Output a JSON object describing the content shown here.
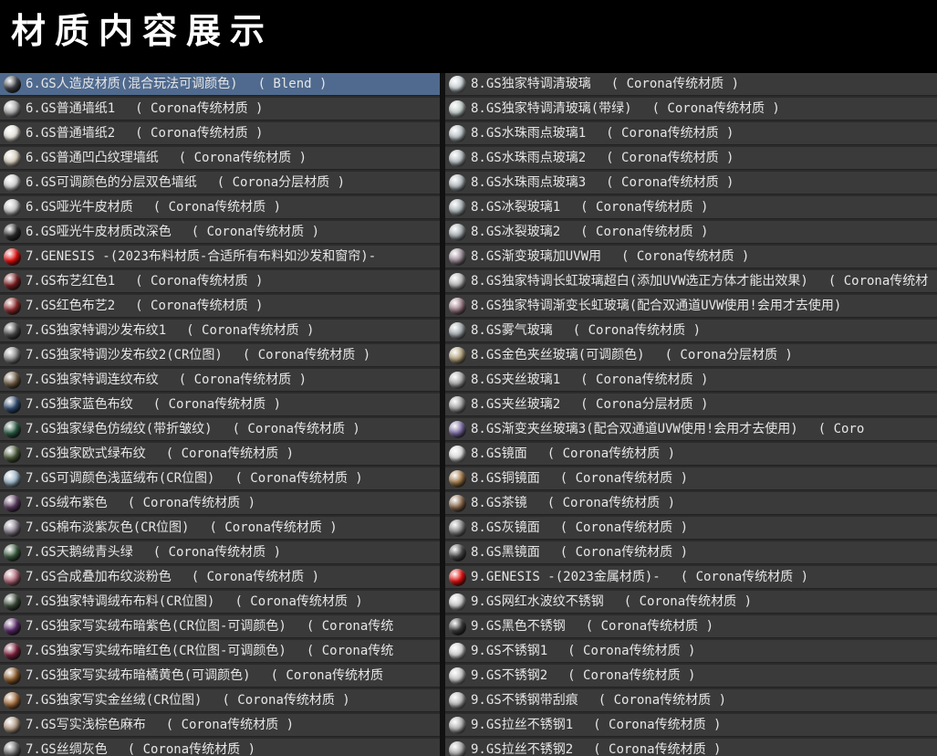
{
  "header": {
    "title": "材质内容展示"
  },
  "colors": {
    "row_bg": "#3a3a3a",
    "row_selected": "#4f6a8e",
    "text": "#e6e6e6",
    "header_bg": "#000000"
  },
  "left_list": [
    {
      "name": "6.GS人造皮材质(混合玩法可调颜色)",
      "tag": "( Blend )",
      "swatch": "#3c3f46",
      "selected": true,
      "icon": "sphere-icon"
    },
    {
      "name": "6.GS普通墙纸1",
      "tag": "( Corona传统材质 )",
      "swatch": "#a8a8a8",
      "icon": "sphere-icon"
    },
    {
      "name": "6.GS普通墙纸2",
      "tag": "( Corona传统材质 )",
      "swatch": "#e6e2da",
      "icon": "sphere-icon"
    },
    {
      "name": "6.GS普通凹凸纹理墙纸",
      "tag": "( Corona传统材质 )",
      "swatch": "#d8cfbe",
      "icon": "sphere-icon"
    },
    {
      "name": "6.GS可调颜色的分层双色墙纸",
      "tag": "( Corona分层材质 )",
      "swatch": "#cfcfcf",
      "icon": "sphere-icon"
    },
    {
      "name": "6.GS哑光牛皮材质",
      "tag": "( Corona传统材质 )",
      "swatch": "#c2c2c2",
      "icon": "sphere-icon"
    },
    {
      "name": "6.GS哑光牛皮材质改深色",
      "tag": "( Corona传统材质 )",
      "swatch": "#2a2a2a",
      "icon": "sphere-icon"
    },
    {
      "name": "7.GENESIS -(2023布料材质-合适所有布料如沙发和窗帘)-",
      "tag": "",
      "swatch": "#e01010",
      "icon": "sphere-icon"
    },
    {
      "name": "7.GS布艺红色1",
      "tag": "( Corona传统材质 )",
      "swatch": "#7a1e22",
      "icon": "sphere-icon"
    },
    {
      "name": "7.GS红色布艺2",
      "tag": "( Corona传统材质 )",
      "swatch": "#8e2a2c",
      "icon": "sphere-icon"
    },
    {
      "name": "7.GS独家特调沙发布纹1",
      "tag": "( Corona传统材质 )",
      "swatch": "#4a4a4a",
      "icon": "sphere-icon"
    },
    {
      "name": "7.GS独家特调沙发布纹2(CR位图)",
      "tag": "( Corona传统材质 )",
      "swatch": "#8a8a8a",
      "icon": "sphere-icon"
    },
    {
      "name": "7.GS独家特调连纹布纹",
      "tag": "( Corona传统材质 )",
      "swatch": "#6e5a44",
      "icon": "sphere-icon"
    },
    {
      "name": "7.GS独家蓝色布纹",
      "tag": "( Corona传统材质 )",
      "swatch": "#2e4a6e",
      "icon": "sphere-icon"
    },
    {
      "name": "7.GS独家绿色仿绒纹(带折皱纹)",
      "tag": "( Corona传统材质 )",
      "swatch": "#2a5a44",
      "icon": "sphere-icon"
    },
    {
      "name": "7.GS独家欧式绿布纹",
      "tag": "( Corona传统材质 )",
      "swatch": "#4a5a3a",
      "icon": "sphere-icon"
    },
    {
      "name": "7.GS可调颜色浅蓝绒布(CR位图)",
      "tag": "( Corona传统材质 )",
      "swatch": "#9cb6c8",
      "icon": "sphere-icon"
    },
    {
      "name": "7.GS绒布紫色",
      "tag": "( Corona传统材质 )",
      "swatch": "#5a3a5e",
      "icon": "sphere-icon"
    },
    {
      "name": "7.GS棉布淡紫灰色(CR位图)",
      "tag": "( Corona传统材质 )",
      "swatch": "#8a8090",
      "icon": "sphere-icon"
    },
    {
      "name": "7.GS天鹅绒青头绿",
      "tag": "( Corona传统材质 )",
      "swatch": "#3a5a3e",
      "icon": "sphere-icon"
    },
    {
      "name": "7.GS合成叠加布纹淡粉色",
      "tag": "( Corona传统材质 )",
      "swatch": "#b06a7a",
      "icon": "sphere-icon"
    },
    {
      "name": "7.GS独家特调绒布布料(CR位图)",
      "tag": "( Corona传统材质 )",
      "swatch": "#3a4a38",
      "icon": "sphere-icon"
    },
    {
      "name": "7.GS独家写实绒布暗紫色(CR位图-可调颜色)",
      "tag": "( Corona传统",
      "swatch": "#5a2a6a",
      "icon": "sphere-icon"
    },
    {
      "name": "7.GS独家写实绒布暗红色(CR位图-可调颜色)",
      "tag": "( Corona传统",
      "swatch": "#7a1e3a",
      "icon": "sphere-icon"
    },
    {
      "name": "7.GS独家写实绒布暗橘黄色(可调颜色)",
      "tag": "( Corona传统材质",
      "swatch": "#8a5a2a",
      "icon": "sphere-icon"
    },
    {
      "name": "7.GS独家写实金丝绒(CR位图)",
      "tag": "( Corona传统材质 )",
      "swatch": "#a06a3a",
      "icon": "sphere-icon"
    },
    {
      "name": "7.GS写实浅棕色麻布",
      "tag": "( Corona传统材质 )",
      "swatch": "#b09a84",
      "icon": "sphere-icon"
    },
    {
      "name": "7.GS丝绸灰色",
      "tag": "( Corona传统材质 )",
      "swatch": "#6a6a6a",
      "icon": "sphere-icon"
    }
  ],
  "right_list": [
    {
      "name": "8.GS独家特调清玻璃",
      "tag": "( Corona传统材质 )",
      "swatch": "#c8d0d4",
      "icon": "glass-icon"
    },
    {
      "name": "8.GS独家特调清玻璃(带绿)",
      "tag": "( Corona传统材质 )",
      "swatch": "#c0ccc8",
      "icon": "glass-icon"
    },
    {
      "name": "8.GS水珠雨点玻璃1",
      "tag": "( Corona传统材质 )",
      "swatch": "#b8c0c4",
      "icon": "glass-icon"
    },
    {
      "name": "8.GS水珠雨点玻璃2",
      "tag": "( Corona传统材质 )",
      "swatch": "#b4bcc0",
      "icon": "glass-icon"
    },
    {
      "name": "8.GS水珠雨点玻璃3",
      "tag": "( Corona传统材质 )",
      "swatch": "#b0b8bc",
      "icon": "glass-icon"
    },
    {
      "name": "8.GS冰裂玻璃1",
      "tag": "( Corona传统材质 )",
      "swatch": "#a8b0b4",
      "icon": "glass-icon"
    },
    {
      "name": "8.GS冰裂玻璃2",
      "tag": "( Corona传统材质 )",
      "swatch": "#a4acb0",
      "icon": "glass-icon"
    },
    {
      "name": "8.GS渐变玻璃加UVW用",
      "tag": "( Corona传统材质 )",
      "swatch": "#9a8a96",
      "icon": "glass-icon"
    },
    {
      "name": "8.GS独家特调长虹玻璃超白(添加UVW选正方体才能出效果)",
      "tag": "( Corona传统材",
      "swatch": "#b4b4b4",
      "icon": "glass-icon"
    },
    {
      "name": "8.GS独家特调渐变长虹玻璃(配合双通道UVW使用!会用才去使用)",
      "tag": "",
      "swatch": "#9a7a86",
      "icon": "glass-icon"
    },
    {
      "name": "8.GS雾气玻璃",
      "tag": "( Corona传统材质 )",
      "swatch": "#a0a8ac",
      "icon": "glass-icon"
    },
    {
      "name": "8.GS金色夹丝玻璃(可调颜色)",
      "tag": "( Corona分层材质 )",
      "swatch": "#b0a07a",
      "icon": "glass-icon"
    },
    {
      "name": "8.GS夹丝玻璃1",
      "tag": "( Corona传统材质 )",
      "swatch": "#a8a8a8",
      "icon": "glass-icon"
    },
    {
      "name": "8.GS夹丝玻璃2",
      "tag": "( Corona分层材质 )",
      "swatch": "#a0a0a0",
      "icon": "glass-icon"
    },
    {
      "name": "8.GS渐变夹丝玻璃3(配合双通道UVW使用!会用才去使用)",
      "tag": "( Coro",
      "swatch": "#7a6aa0",
      "icon": "glass-icon"
    },
    {
      "name": "8.GS镜面",
      "tag": "( Corona传统材质 )",
      "swatch": "#d8d8d8",
      "icon": "mirror-sphere-icon"
    },
    {
      "name": "8.GS铜镜面",
      "tag": "( Corona传统材质 )",
      "swatch": "#a07848",
      "icon": "mirror-sphere-icon"
    },
    {
      "name": "8.GS茶镜",
      "tag": "( Corona传统材质 )",
      "swatch": "#8a6a4e",
      "icon": "mirror-sphere-icon"
    },
    {
      "name": "8.GS灰镜面",
      "tag": "( Corona传统材质 )",
      "swatch": "#8a8a8a",
      "icon": "mirror-sphere-icon"
    },
    {
      "name": "8.GS黑镜面",
      "tag": "( Corona传统材质 )",
      "swatch": "#4a4a4a",
      "icon": "mirror-sphere-icon"
    },
    {
      "name": "9.GENESIS -(2023金属材质)-",
      "tag": "( Corona传统材质 )",
      "swatch": "#e01010",
      "icon": "sphere-icon"
    },
    {
      "name": "9.GS网红水波纹不锈钢",
      "tag": "( Corona传统材质 )",
      "swatch": "#c8c8c8",
      "icon": "metal-sphere-icon"
    },
    {
      "name": "9.GS黑色不锈钢",
      "tag": "( Corona传统材质 )",
      "swatch": "#3a3a3a",
      "icon": "metal-sphere-icon"
    },
    {
      "name": "9.GS不锈钢1",
      "tag": "( Corona传统材质 )",
      "swatch": "#cfcfcf",
      "icon": "metal-sphere-icon"
    },
    {
      "name": "9.GS不锈钢2",
      "tag": "( Corona传统材质 )",
      "swatch": "#c4c4c4",
      "icon": "metal-sphere-icon"
    },
    {
      "name": "9.GS不锈钢带刮痕",
      "tag": "( Corona传统材质 )",
      "swatch": "#b8b8b8",
      "icon": "metal-sphere-icon"
    },
    {
      "name": "9.GS拉丝不锈钢1",
      "tag": "( Corona传统材质 )",
      "swatch": "#b0b0b0",
      "icon": "metal-sphere-icon"
    },
    {
      "name": "9.GS拉丝不锈钢2",
      "tag": "( Corona传统材质 )",
      "swatch": "#a8a8a8",
      "icon": "metal-sphere-icon"
    }
  ]
}
